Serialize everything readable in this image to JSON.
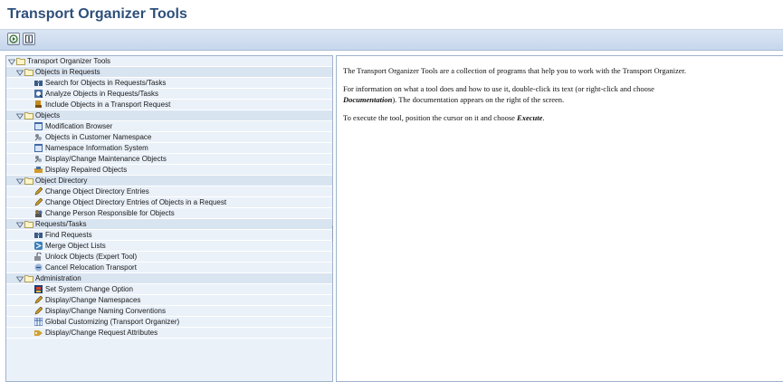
{
  "window": {
    "title": "Transport Organizer Tools"
  },
  "toolbar": {
    "buttons": [
      {
        "name": "execute-icon",
        "color": "#2d6a2a"
      },
      {
        "name": "documentation-icon",
        "color": "#2e3b4e"
      }
    ]
  },
  "tree": {
    "root": "Transport Organizer Tools",
    "groups": [
      {
        "label": "Objects in Requests",
        "items": [
          {
            "label": "Search for Objects in Requests/Tasks",
            "icon": "binoculars-icon"
          },
          {
            "label": "Analyze Objects in Requests/Tasks",
            "icon": "analyze-icon"
          },
          {
            "label": "Include Objects in a Transport Request",
            "icon": "truck-icon"
          }
        ]
      },
      {
        "label": "Objects",
        "items": [
          {
            "label": "Modification Browser",
            "icon": "browser-icon"
          },
          {
            "label": "Objects in Customer Namespace",
            "icon": "objects-icon"
          },
          {
            "label": "Namespace Information System",
            "icon": "browser-icon"
          },
          {
            "label": "Display/Change Maintenance Objects",
            "icon": "objects-icon"
          },
          {
            "label": "Display Repaired Objects",
            "icon": "repair-icon"
          }
        ]
      },
      {
        "label": "Object Directory",
        "items": [
          {
            "label": "Change Object Directory Entries",
            "icon": "pencil-icon"
          },
          {
            "label": "Change Object Directory Entries of Objects in a Request",
            "icon": "pencil-icon"
          },
          {
            "label": "Change Person Responsible for Objects",
            "icon": "persons-icon"
          }
        ]
      },
      {
        "label": "Requests/Tasks",
        "items": [
          {
            "label": "Find Requests",
            "icon": "binoculars-icon"
          },
          {
            "label": "Merge Object Lists",
            "icon": "merge-icon"
          },
          {
            "label": "Unlock Objects (Expert Tool)",
            "icon": "unlock-icon"
          },
          {
            "label": "Cancel Relocation Transport",
            "icon": "cancel-icon"
          }
        ]
      },
      {
        "label": "Administration",
        "items": [
          {
            "label": "Set System Change Option",
            "icon": "system-icon"
          },
          {
            "label": "Display/Change Namespaces",
            "icon": "pencil-icon"
          },
          {
            "label": "Display/Change Naming Conventions",
            "icon": "pencil-icon"
          },
          {
            "label": "Global Customizing (Transport Organizer)",
            "icon": "table-icon"
          },
          {
            "label": "Display/Change Request Attributes",
            "icon": "attribute-icon"
          }
        ]
      }
    ]
  },
  "doc": {
    "p1": "The Transport Organizer Tools are a collection of programs that help you to work with the Transport Organizer.",
    "p2a": "For information on what a tool does and how to use it, double-click its text (or right-click and choose",
    "p2b_emph": "Documentation",
    "p2c": "). The documentation appears on the right of the screen.",
    "p3a": "To execute the tool, position the cursor on it and choose",
    "p3b_emph": "Execute",
    "p3c": "."
  }
}
